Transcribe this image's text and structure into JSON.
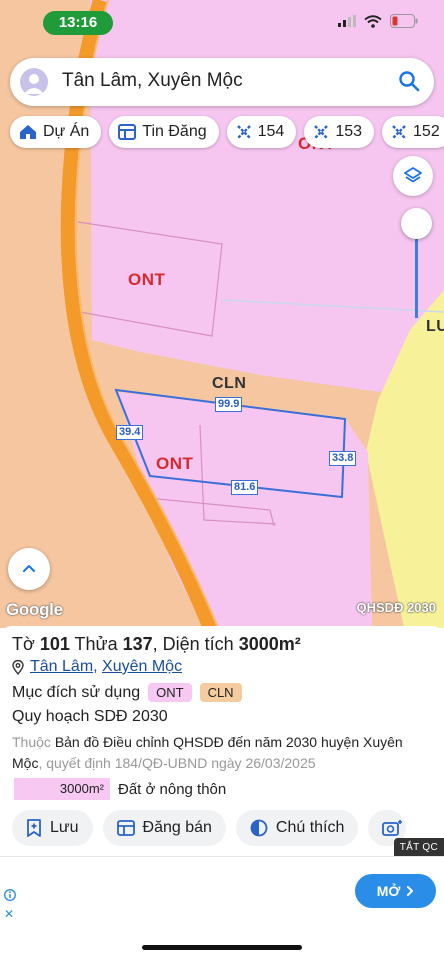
{
  "status": {
    "time": "13:16"
  },
  "search": {
    "text": "Tân Lâm, Xuyên Mộc"
  },
  "chips": [
    {
      "label": "Dự Án",
      "icon": "home-icon"
    },
    {
      "label": "Tin Đăng",
      "icon": "listing-icon"
    },
    {
      "label": "154",
      "icon": "plot-icon"
    },
    {
      "label": "153",
      "icon": "plot-icon"
    },
    {
      "label": "152",
      "icon": "plot-icon"
    }
  ],
  "map": {
    "labels": {
      "ont_top": "ONT",
      "ont_top_partial": "ONT",
      "ont_main": "ONT",
      "cln": "CLN",
      "lu_partial": "LU"
    },
    "dimensions": {
      "top": "99.9",
      "left": "39.4",
      "right": "33.8",
      "bottom": "81.6"
    },
    "attribution": "Google",
    "layer_tag": "QHSDĐ 2030",
    "colors": {
      "ont": "#f6c6f0",
      "cln": "#f5c6a0",
      "lu": "#f7f29a",
      "road": "#f39a2a",
      "outline": "#3a6fd8"
    }
  },
  "panel": {
    "title_prefix": "Tờ ",
    "sheet": "101",
    "title_mid": " Thửa ",
    "parcel": "137",
    "title_suffix": ", Diện tích ",
    "area": "3000m²",
    "location_commune": "Tân Lâm",
    "location_sep": ", ",
    "location_district": "Xuyên Mộc",
    "purpose_label": "Mục đích sử dụng",
    "purpose_tags": [
      "ONT",
      "CLN"
    ],
    "plan_label": "Quy hoạch SDĐ 2030",
    "desc_muted_1": "Thuộc ",
    "desc_main": "Bản đồ Điều chỉnh QHSDĐ đến năm 2030 huyện Xuyên Mộc",
    "desc_muted_2": ", quyết định 184/QĐ-UBND ngày 26/03/2025",
    "legend_area": "3000m²",
    "legend_text": "Đất ở nông thôn"
  },
  "actions": [
    {
      "label": "Lưu",
      "icon": "bookmark-add-icon"
    },
    {
      "label": "Đăng bán",
      "icon": "listing-icon"
    },
    {
      "label": "Chú thích",
      "icon": "contrast-icon"
    },
    {
      "label": "",
      "icon": "camera-icon"
    }
  ],
  "ad": {
    "close_label": "TẮT QC",
    "cta": "MỞ"
  }
}
